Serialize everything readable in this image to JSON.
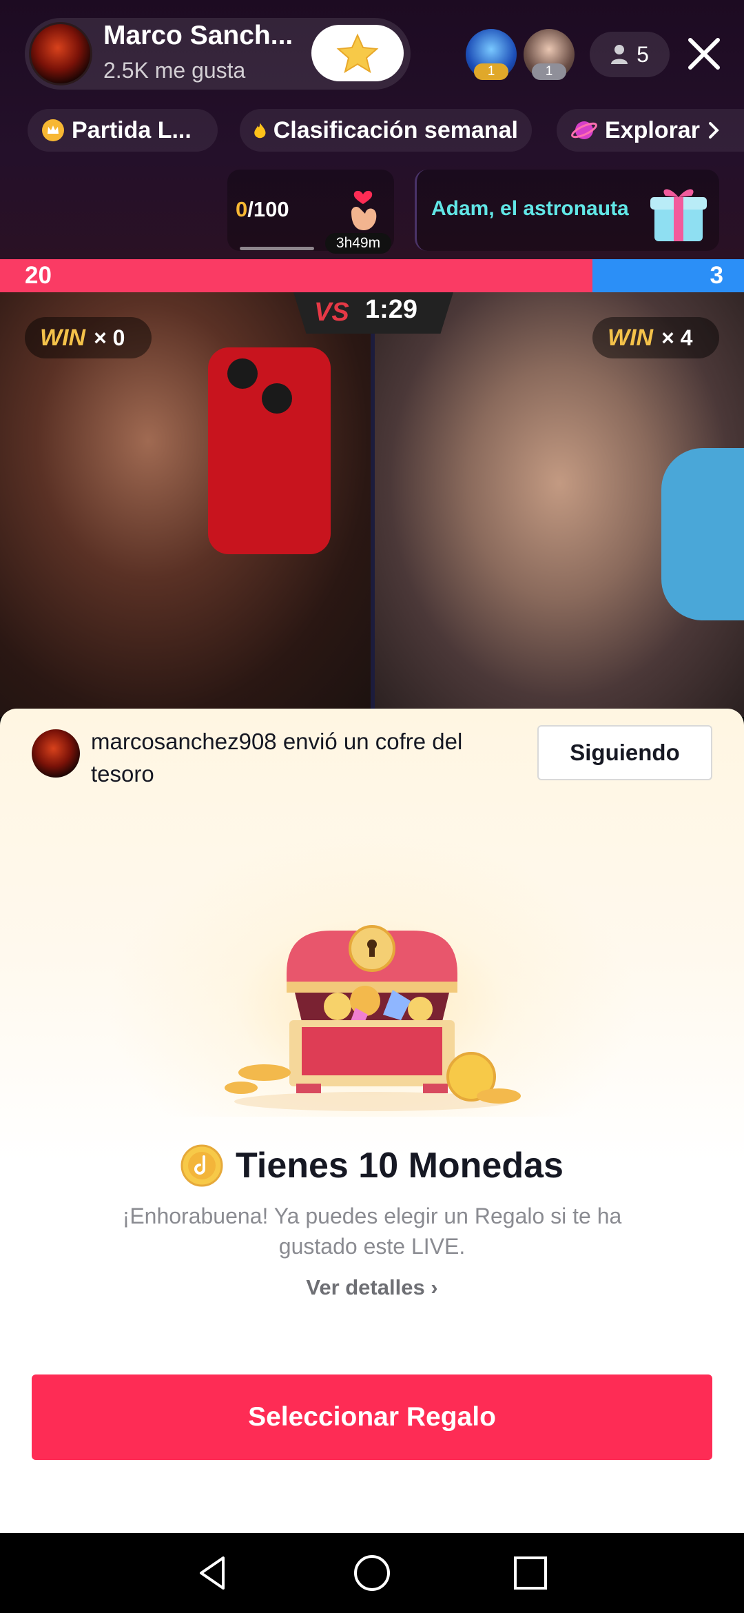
{
  "header": {
    "host_name": "Marco Sanch...",
    "host_likes": "2.5K me gusta",
    "viewer_badges": [
      "1",
      "1"
    ],
    "viewer_count": "5"
  },
  "tags": [
    {
      "label": "Partida L..."
    },
    {
      "label": "Clasificación semanal"
    },
    {
      "label": "Explorar"
    }
  ],
  "goal": {
    "current": "0",
    "total": "/100",
    "timer": "3h49m"
  },
  "promo": {
    "text": "Adam, el astronauta"
  },
  "battle": {
    "left_score": "20",
    "right_score": "3",
    "vs_label": "VS",
    "timer": "1:29",
    "left_win_label": "WIN",
    "left_win_count": "× 0",
    "right_win_label": "WIN",
    "right_win_count": "× 4"
  },
  "sheet": {
    "sender_text": "marcosanchez908 envió un cofre del tesoro",
    "following_label": "Siguiendo",
    "coins_title": "Tienes 10 Monedas",
    "subtitle": "¡Enhorabuena! Ya puedes elegir un Regalo si te ha gustado este LIVE.",
    "details_label": "Ver detalles ›",
    "primary_button": "Seleccionar Regalo"
  },
  "colors": {
    "accent": "#fe2c55",
    "score_red": "#fa3b64",
    "score_blue": "#2b8ff7",
    "win_gold": "#f4c24a",
    "promo_cyan": "#61e6e6"
  },
  "icons": [
    "star-icon",
    "person-icon",
    "close-icon",
    "crown-icon",
    "flame-icon",
    "planet-icon",
    "chevron-right-icon",
    "heart-hand-icon",
    "gift-icon",
    "treasure-chest-icon",
    "coin-icon",
    "back-icon",
    "home-icon",
    "recents-icon"
  ]
}
